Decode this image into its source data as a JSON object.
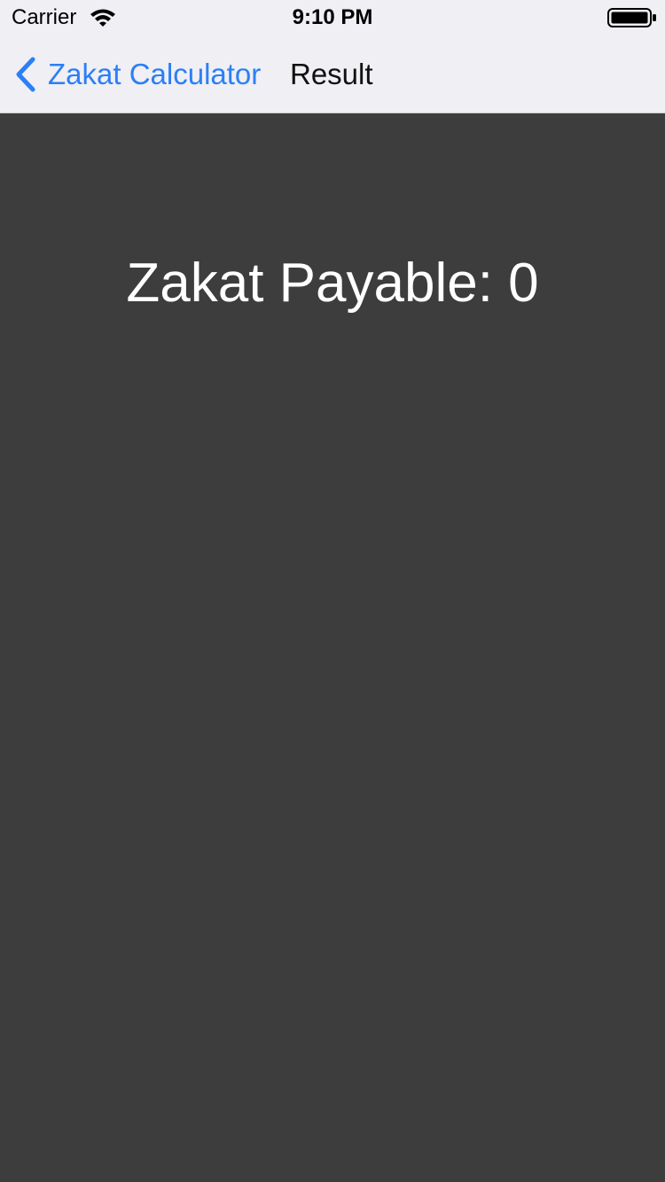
{
  "status_bar": {
    "carrier": "Carrier",
    "time": "9:10 PM",
    "wifi_icon": "wifi-icon",
    "battery_icon": "battery-icon"
  },
  "nav_bar": {
    "back_label": "Zakat Calculator",
    "back_icon": "chevron-back-icon",
    "title": "Result"
  },
  "content": {
    "result_text": "Zakat Payable: 0"
  },
  "colors": {
    "accent": "#2c7ff5",
    "nav_background": "#efeff4",
    "content_background": "#3d3d3d",
    "result_text": "#ffffff"
  }
}
